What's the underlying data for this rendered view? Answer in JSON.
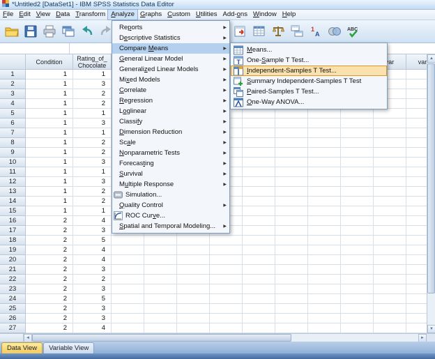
{
  "colors": {
    "menu_highlight": "#b3d0ee",
    "submenu_highlight_bg": "#fbe1ad",
    "submenu_highlight_border": "#e0971f",
    "active_tab": "#f4cb5e",
    "status_bar": "#44699e"
  },
  "titlebar": {
    "title": "*Untitled2 [DataSet1] - IBM SPSS Statistics Data Editor",
    "icon": "spss-app-icon"
  },
  "menubar": {
    "items": [
      {
        "label": "File",
        "accel": 0
      },
      {
        "label": "Edit",
        "accel": 0
      },
      {
        "label": "View",
        "accel": 0
      },
      {
        "label": "Data",
        "accel": 0
      },
      {
        "label": "Transform",
        "accel": 0
      },
      {
        "label": "Analyze",
        "accel": 0,
        "open": true
      },
      {
        "label": "Graphs",
        "accel": 0
      },
      {
        "label": "Custom",
        "accel": 0
      },
      {
        "label": "Utilities",
        "accel": 0
      },
      {
        "label": "Add-ons",
        "accel": 4
      },
      {
        "label": "Window",
        "accel": 0
      },
      {
        "label": "Help",
        "accel": 0
      }
    ]
  },
  "toolbar": {
    "left_icons": [
      "open-data-icon",
      "save-icon",
      "print-icon",
      "recall-dialogs-icon",
      "undo-icon",
      "redo-icon"
    ],
    "right_icons": [
      "goto-case-icon",
      "variables-icon",
      "weight-cases-icon",
      "split-file-icon",
      "value-labels-icon",
      "use-sets-icon",
      "spell-check-icon"
    ]
  },
  "analyze_menu": {
    "items": [
      {
        "label": "Reports",
        "accel": 2,
        "arrow": true
      },
      {
        "label": "Descriptive Statistics",
        "accel": 1,
        "arrow": true
      },
      {
        "label": "Compare Means",
        "accel": 8,
        "arrow": true,
        "highlighted": true
      },
      {
        "label": "General Linear Model",
        "accel": 0,
        "arrow": true
      },
      {
        "label": "Generalized Linear Models",
        "accel": 8,
        "arrow": true
      },
      {
        "label": "Mixed Models",
        "accel": 2,
        "arrow": true
      },
      {
        "label": "Correlate",
        "accel": 0,
        "arrow": true
      },
      {
        "label": "Regression",
        "accel": 0,
        "arrow": true
      },
      {
        "label": "Loglinear",
        "accel": 1,
        "arrow": true
      },
      {
        "label": "Classify",
        "accel": 6,
        "arrow": true
      },
      {
        "label": "Dimension Reduction",
        "accel": 0,
        "arrow": true
      },
      {
        "label": "Scale",
        "accel": 2,
        "arrow": true
      },
      {
        "label": "Nonparametric Tests",
        "accel": 0,
        "arrow": true
      },
      {
        "label": "Forecasting",
        "accel": 7,
        "arrow": true
      },
      {
        "label": "Survival",
        "accel": 0,
        "arrow": true
      },
      {
        "label": "Multiple Response",
        "accel": 1,
        "arrow": true
      },
      {
        "label": "Simulation...",
        "icon": "simulation-icon",
        "arrow": false
      },
      {
        "label": "Quality Control",
        "accel": 0,
        "arrow": true
      },
      {
        "label": "ROC Curve...",
        "accel": 7,
        "icon": "roc-curve-icon",
        "arrow": false
      },
      {
        "label": "Spatial and Temporal Modeling...",
        "accel": 0,
        "arrow": true
      }
    ]
  },
  "compare_means_menu": {
    "items": [
      {
        "label": "Means...",
        "accel": 0,
        "icon": "means-icon"
      },
      {
        "label": "One-Sample T Test...",
        "accel": 4,
        "icon": "one-sample-t-icon"
      },
      {
        "label": "Independent-Samples T Test...",
        "accel": 0,
        "icon": "independent-samples-t-icon",
        "highlighted": true
      },
      {
        "label": "Summary Independent-Samples T Test",
        "accel": 0,
        "icon": "summary-independent-t-icon"
      },
      {
        "label": "Paired-Samples T Test...",
        "accel": 0,
        "icon": "paired-samples-t-icon"
      },
      {
        "label": "One-Way ANOVA...",
        "accel": 0,
        "icon": "one-way-anova-icon"
      }
    ]
  },
  "grid": {
    "corner_label": "",
    "columns": [
      {
        "label": "Condition"
      },
      {
        "label": "Rating_of_Chocolate"
      }
    ],
    "var_column_label": "var",
    "var_column_count": 10,
    "rows": [
      {
        "n": "1",
        "condition": "1",
        "rating": "1"
      },
      {
        "n": "2",
        "condition": "1",
        "rating": "3"
      },
      {
        "n": "3",
        "condition": "1",
        "rating": "2"
      },
      {
        "n": "4",
        "condition": "1",
        "rating": "2"
      },
      {
        "n": "5",
        "condition": "1",
        "rating": "1"
      },
      {
        "n": "6",
        "condition": "1",
        "rating": "3"
      },
      {
        "n": "7",
        "condition": "1",
        "rating": "1"
      },
      {
        "n": "8",
        "condition": "1",
        "rating": "2"
      },
      {
        "n": "9",
        "condition": "1",
        "rating": "2"
      },
      {
        "n": "10",
        "condition": "1",
        "rating": "3"
      },
      {
        "n": "11",
        "condition": "1",
        "rating": "1"
      },
      {
        "n": "12",
        "condition": "1",
        "rating": "3"
      },
      {
        "n": "13",
        "condition": "1",
        "rating": "2"
      },
      {
        "n": "14",
        "condition": "1",
        "rating": "2"
      },
      {
        "n": "15",
        "condition": "1",
        "rating": "1"
      },
      {
        "n": "16",
        "condition": "2",
        "rating": "4"
      },
      {
        "n": "17",
        "condition": "2",
        "rating": "3"
      },
      {
        "n": "18",
        "condition": "2",
        "rating": "5"
      },
      {
        "n": "19",
        "condition": "2",
        "rating": "4"
      },
      {
        "n": "20",
        "condition": "2",
        "rating": "4"
      },
      {
        "n": "21",
        "condition": "2",
        "rating": "3"
      },
      {
        "n": "22",
        "condition": "2",
        "rating": "2"
      },
      {
        "n": "23",
        "condition": "2",
        "rating": "3"
      },
      {
        "n": "24",
        "condition": "2",
        "rating": "5"
      },
      {
        "n": "25",
        "condition": "2",
        "rating": "3"
      },
      {
        "n": "26",
        "condition": "2",
        "rating": "3"
      },
      {
        "n": "27",
        "condition": "2",
        "rating": "4"
      }
    ]
  },
  "tabs": {
    "items": [
      {
        "label": "Data View",
        "active": true
      },
      {
        "label": "Variable View",
        "active": false
      }
    ]
  },
  "scrollbars": {
    "up_glyph": "▲",
    "down_glyph": "▼",
    "left_glyph": "◄",
    "right_glyph": "►",
    "submenu_arrow": "▶"
  }
}
